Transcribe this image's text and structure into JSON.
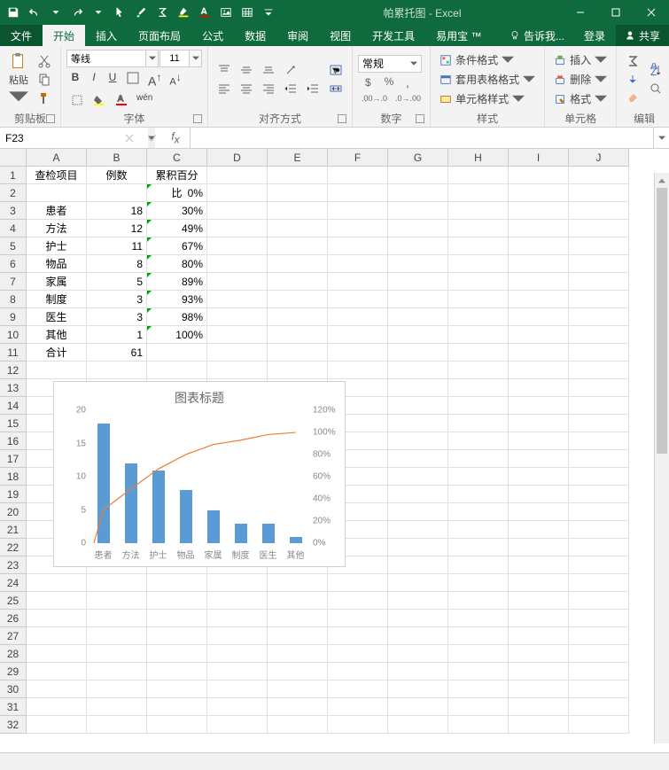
{
  "app": {
    "title": "帕累托图 - Excel"
  },
  "qat": [
    "save",
    "undo",
    "redo",
    "touch",
    "brush",
    "sum",
    "highlight",
    "font-color",
    "picture",
    "table",
    "more"
  ],
  "tabs": {
    "file": "文件",
    "items": [
      "开始",
      "插入",
      "页面布局",
      "公式",
      "数据",
      "审阅",
      "视图",
      "开发工具",
      "易用宝 ™"
    ],
    "active": 0,
    "tell_me": "告诉我...",
    "login": "登录",
    "share": "共享"
  },
  "ribbon": {
    "clipboard": {
      "label": "剪贴板",
      "paste": "粘贴"
    },
    "font": {
      "label": "字体",
      "name": "等线",
      "size": "11",
      "btns_wen": "wén"
    },
    "alignment": {
      "label": "对齐方式"
    },
    "number": {
      "label": "数字",
      "format": "常规"
    },
    "styles": {
      "label": "样式",
      "cond": "条件格式",
      "table": "套用表格格式",
      "cell": "单元格样式"
    },
    "cells": {
      "label": "单元格",
      "insert": "插入",
      "delete": "删除",
      "format": "格式"
    },
    "editing": {
      "label": "编辑"
    }
  },
  "namebox": {
    "value": "F23"
  },
  "formula": {
    "value": ""
  },
  "columns": [
    "A",
    "B",
    "C",
    "D",
    "E",
    "F",
    "G",
    "H",
    "I",
    "J"
  ],
  "rows": 32,
  "sheet": {
    "header": [
      "查检项目",
      "例数",
      "累积百分比"
    ],
    "data": [
      [
        "",
        "",
        "0%"
      ],
      [
        "患者",
        "18",
        "30%"
      ],
      [
        "方法",
        "12",
        "49%"
      ],
      [
        "护士",
        "11",
        "67%"
      ],
      [
        "物品",
        "8",
        "80%"
      ],
      [
        "家属",
        "5",
        "89%"
      ],
      [
        "制度",
        "3",
        "93%"
      ],
      [
        "医生",
        "3",
        "98%"
      ],
      [
        "其他",
        "1",
        "100%"
      ],
      [
        "合计",
        "61",
        ""
      ]
    ]
  },
  "chart_data": {
    "type": "bar",
    "title": "图表标题",
    "categories": [
      "患者",
      "方法",
      "护士",
      "物品",
      "家属",
      "制度",
      "医生",
      "其他"
    ],
    "series": [
      {
        "name": "例数",
        "type": "bar",
        "axis": "left",
        "values": [
          18,
          12,
          11,
          8,
          5,
          3,
          3,
          1
        ]
      },
      {
        "name": "累积百分比",
        "type": "line",
        "axis": "right",
        "values": [
          0.3,
          0.49,
          0.67,
          0.8,
          0.89,
          0.93,
          0.98,
          1.0
        ]
      }
    ],
    "ylim_left": [
      0,
      20
    ],
    "yticks_left": [
      0,
      5,
      10,
      15,
      20
    ],
    "ylim_right": [
      0,
      1.2
    ],
    "yticks_right": [
      "0%",
      "20%",
      "40%",
      "60%",
      "80%",
      "100%",
      "120%"
    ],
    "colors": {
      "bar": "#5b9bd5",
      "line": "#ed7d31"
    }
  }
}
